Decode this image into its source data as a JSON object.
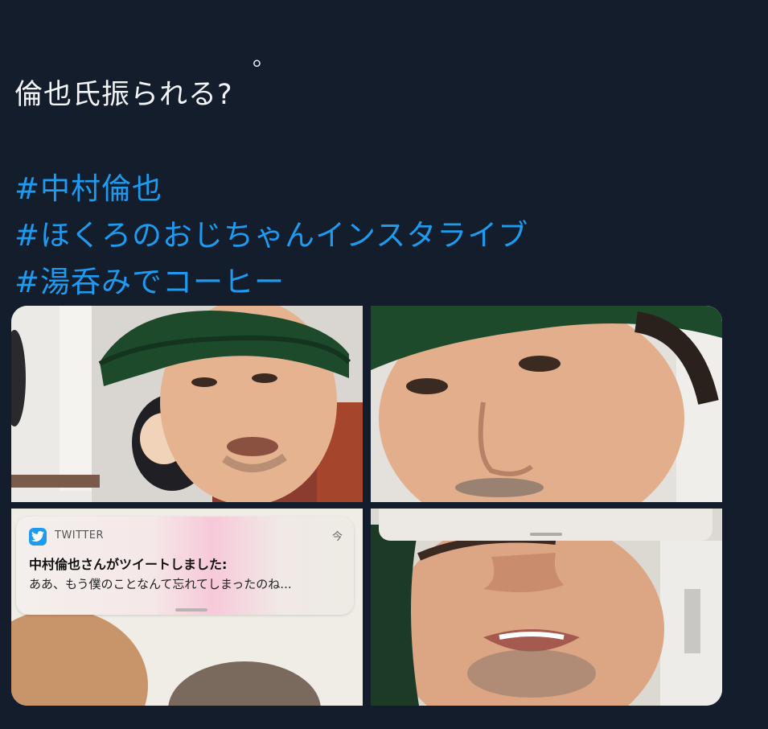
{
  "tweet": {
    "cut_off_line_end": "。",
    "body": "倫也氏振られる?",
    "hashtags": [
      "#中村倫也",
      "#ほくろのおじちゃんインスタライブ",
      "#湯呑みでコーヒー"
    ]
  },
  "media": {
    "notification": {
      "app_icon": "twitter-bird-icon",
      "app_name": "TWITTER",
      "time": "今",
      "title": "中村倫也さんがツイートしました:",
      "body": "ああ、もう僕のことなんて忘れてしまったのね..."
    }
  },
  "colors": {
    "background": "#141d2b",
    "text": "#f2f4f6",
    "hashtag": "#1d9bf0"
  }
}
